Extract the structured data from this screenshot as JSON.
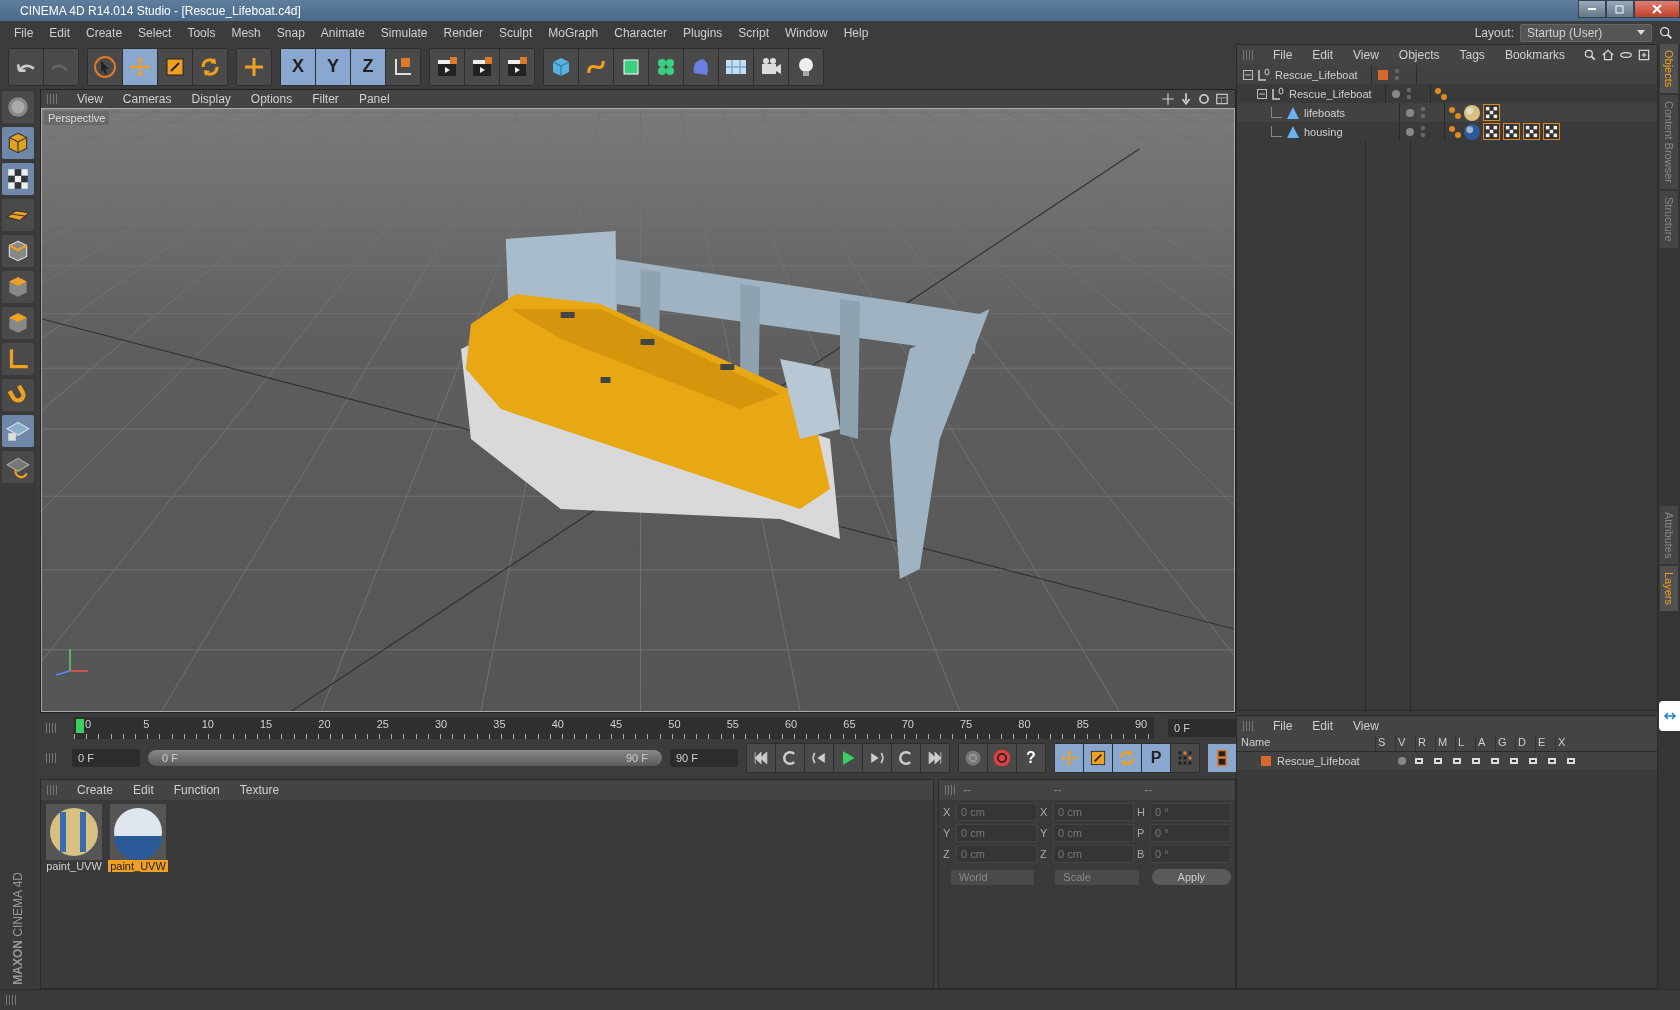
{
  "window": {
    "title": "CINEMA 4D R14.014 Studio - [Rescue_Lifeboat.c4d]"
  },
  "menu": [
    "File",
    "Edit",
    "Create",
    "Select",
    "Tools",
    "Mesh",
    "Snap",
    "Animate",
    "Simulate",
    "Render",
    "Sculpt",
    "MoGraph",
    "Character",
    "Plugins",
    "Script",
    "Window",
    "Help"
  ],
  "layout": {
    "label": "Layout:",
    "value": "Startup (User)"
  },
  "tools": [
    {
      "kind": "select",
      "selected": false
    },
    {
      "kind": "move",
      "selected": true
    },
    {
      "kind": "scale",
      "selected": false
    },
    {
      "kind": "rotate",
      "selected": false
    }
  ],
  "axis_buttons": [
    {
      "label": "X",
      "selected": true
    },
    {
      "label": "Y",
      "selected": true
    },
    {
      "label": "Z",
      "selected": true
    }
  ],
  "viewport": {
    "menu": [
      "View",
      "Cameras",
      "Display",
      "Options",
      "Filter",
      "Panel"
    ],
    "label": "Perspective"
  },
  "objects_panel": {
    "menu": [
      "File",
      "Edit",
      "View",
      "Objects",
      "Tags",
      "Bookmarks"
    ],
    "tree": [
      {
        "name": "Rescue_Lifeboat",
        "kind": "null",
        "color": "#d4692b",
        "children": [
          {
            "name": "Rescue_Lifeboat",
            "kind": "null",
            "tags": [
              {
                "kind": "phong"
              }
            ],
            "children": [
              {
                "name": "lifeboats",
                "kind": "mesh",
                "tags": [
                  {
                    "kind": "phong"
                  },
                  {
                    "kind": "material-yellow"
                  },
                  {
                    "kind": "uvw"
                  }
                ]
              },
              {
                "name": "housing",
                "kind": "mesh",
                "tags": [
                  {
                    "kind": "phong"
                  },
                  {
                    "kind": "material-blue"
                  },
                  {
                    "kind": "uvw"
                  },
                  {
                    "kind": "uvw"
                  },
                  {
                    "kind": "uvw"
                  },
                  {
                    "kind": "uvw"
                  }
                ]
              }
            ]
          }
        ]
      }
    ]
  },
  "side_tabs_top": [
    {
      "label": "Objects",
      "selected": true
    },
    {
      "label": "Content Browser",
      "selected": false
    },
    {
      "label": "Structure",
      "selected": false
    }
  ],
  "side_tabs_bottom": [
    {
      "label": "Attributes",
      "selected": false
    },
    {
      "label": "Layers",
      "selected": true
    }
  ],
  "timeline": {
    "ticks": [
      "0",
      "5",
      "10",
      "15",
      "20",
      "25",
      "30",
      "35",
      "40",
      "45",
      "50",
      "55",
      "60",
      "65",
      "70",
      "75",
      "80",
      "85",
      "90"
    ],
    "current_frame": "0 F",
    "level": 0
  },
  "transport": {
    "start": "0 F",
    "range": {
      "start": "0 F",
      "end": "90 F",
      "level": 1
    },
    "end": "90 F",
    "help": "?",
    "key_tools": [
      {
        "kind": "move",
        "selected": true
      },
      {
        "kind": "scale",
        "selected": true
      },
      {
        "kind": "rotate",
        "selected": true
      },
      {
        "kind": "param",
        "label": "P",
        "selected": true
      },
      {
        "kind": "grid",
        "selected": false
      }
    ]
  },
  "materials_panel": {
    "menu": [
      "Create",
      "Edit",
      "Function",
      "Texture"
    ],
    "materials": [
      {
        "name": "paint_UVW",
        "kind": "yellow",
        "selected": false
      },
      {
        "name": "paint_UVW",
        "kind": "blue",
        "selected": true
      }
    ]
  },
  "coordinates": {
    "headers": [
      "--",
      "--",
      "--"
    ],
    "rows": [
      {
        "a": "X",
        "a_value": "0 cm",
        "b": "X",
        "b_value": "0 cm",
        "c": "H",
        "c_value": "0 °"
      },
      {
        "a": "Y",
        "a_value": "0 cm",
        "b": "Y",
        "b_value": "0 cm",
        "c": "P",
        "c_value": "0 °"
      },
      {
        "a": "Z",
        "a_value": "0 cm",
        "b": "Z",
        "b_value": "0 cm",
        "c": "B",
        "c_value": "0 °"
      }
    ],
    "space": "World",
    "mode": "Scale",
    "apply": "Apply"
  },
  "layers_panel": {
    "menu": [
      "File",
      "Edit",
      "View"
    ],
    "columns": [
      "Name",
      "S",
      "V",
      "R",
      "M",
      "L",
      "A",
      "G",
      "D",
      "E",
      "X"
    ],
    "rows": [
      {
        "name": "Rescue_Lifeboat",
        "color": "#d4692b"
      }
    ]
  },
  "logo": {
    "line1": "MAXON",
    "line2": "CINEMA 4D"
  }
}
